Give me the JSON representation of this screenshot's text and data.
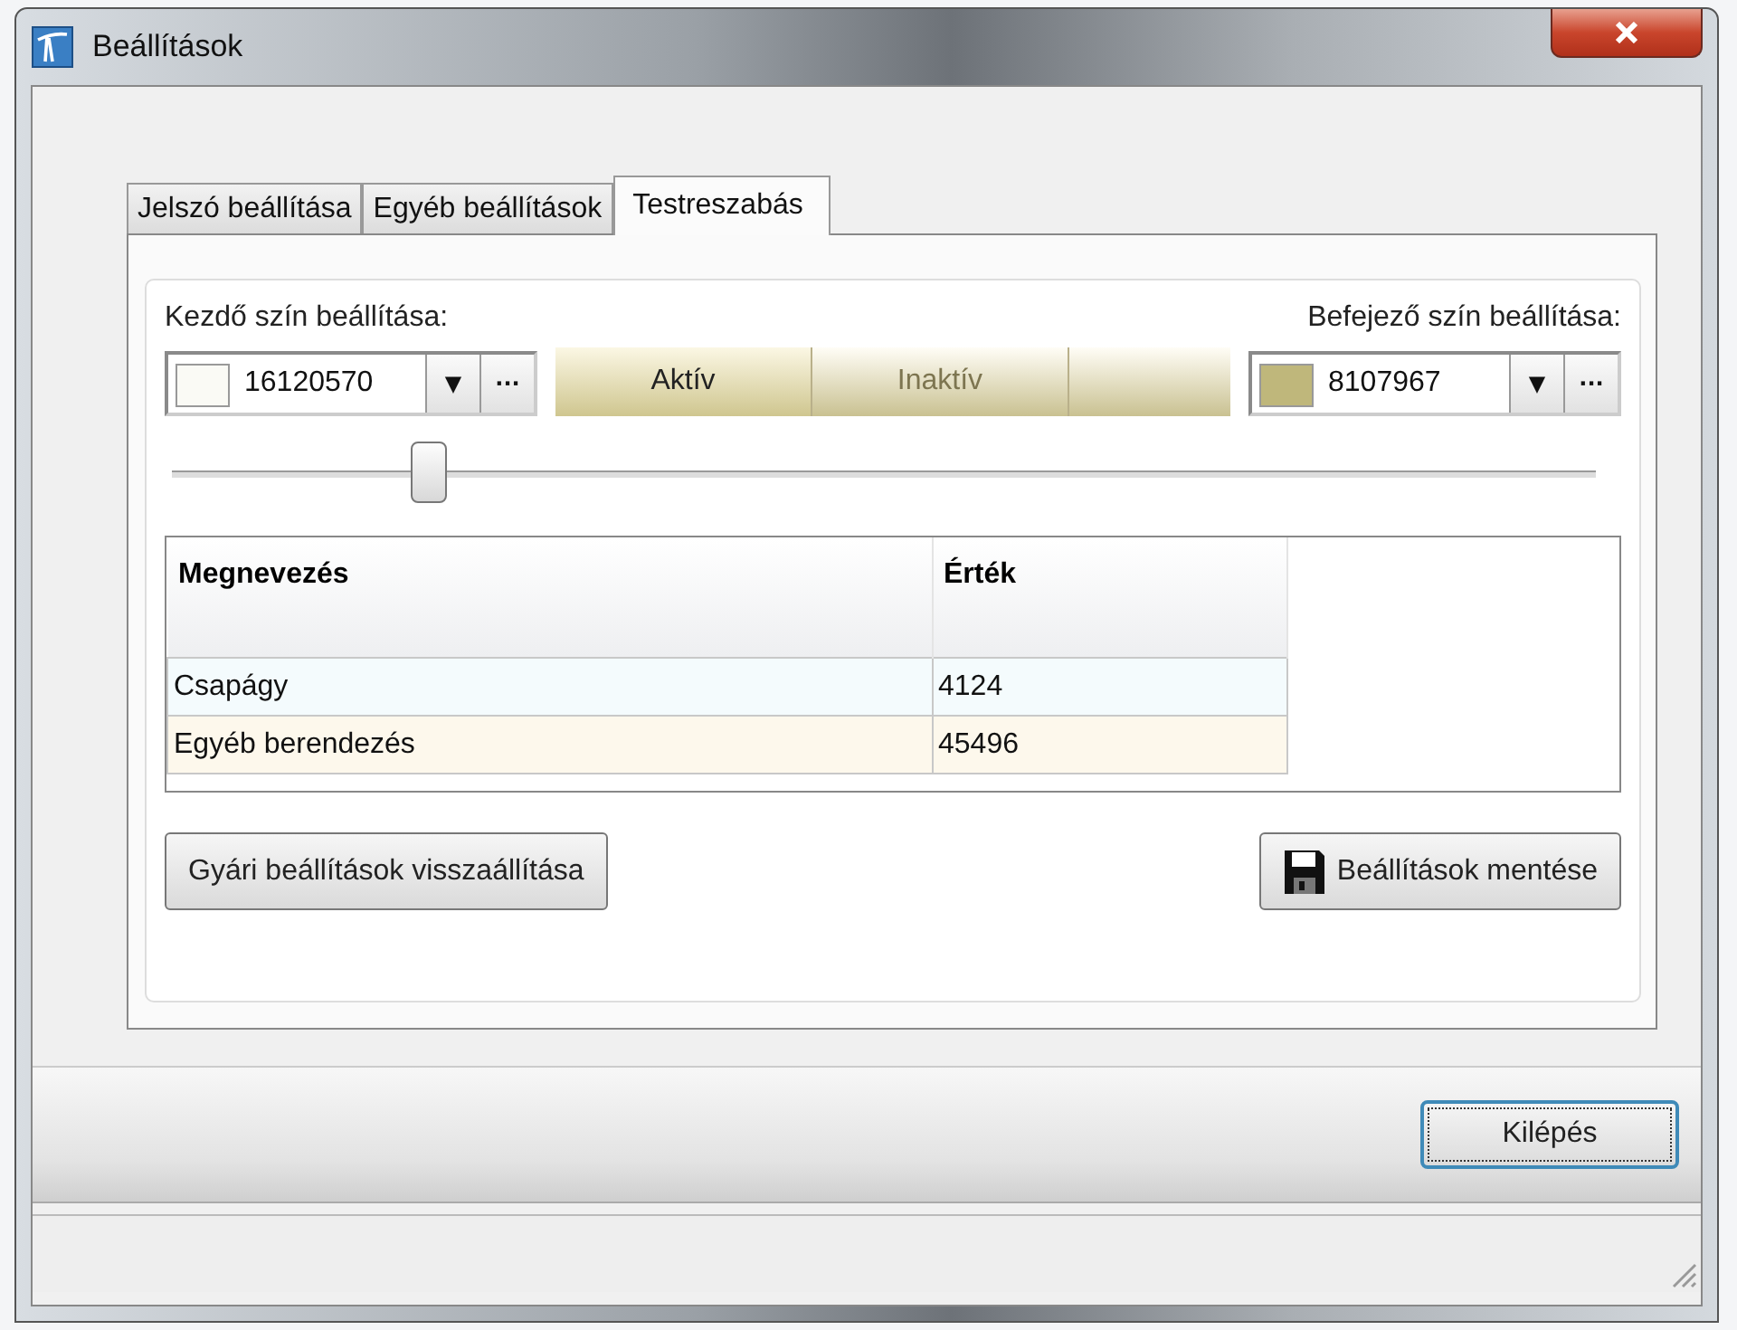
{
  "window": {
    "title": "Beállítások"
  },
  "tabs": [
    {
      "label": "Jelszó beállítása",
      "selected": false
    },
    {
      "label": "Egyéb beállítások",
      "selected": false
    },
    {
      "label": "Testreszabás",
      "selected": true
    }
  ],
  "start_color": {
    "label": "Kezdő szín beállítása:",
    "value": "16120570",
    "color": "#fafaf5",
    "dropdown": "▼",
    "more": "···"
  },
  "end_color": {
    "label": "Befejező szín beállítása:",
    "value": "8107967",
    "color": "#bfb77b",
    "dropdown": "▼",
    "more": "···"
  },
  "state_buttons": [
    {
      "label": "Aktív",
      "selected": true,
      "disabled": false
    },
    {
      "label": "Inaktív",
      "selected": false,
      "disabled": true
    }
  ],
  "slider": {
    "level": 0.18
  },
  "table": {
    "columns": [
      "Megnevezés",
      "Érték"
    ],
    "rows": [
      [
        "Csapágy",
        "4124"
      ],
      [
        "Egyéb berendezés",
        "45496"
      ]
    ]
  },
  "buttons": {
    "reset": "Gyári beállítások visszaállítása",
    "save": "Beállítások mentése",
    "exit": "Kilépés"
  }
}
